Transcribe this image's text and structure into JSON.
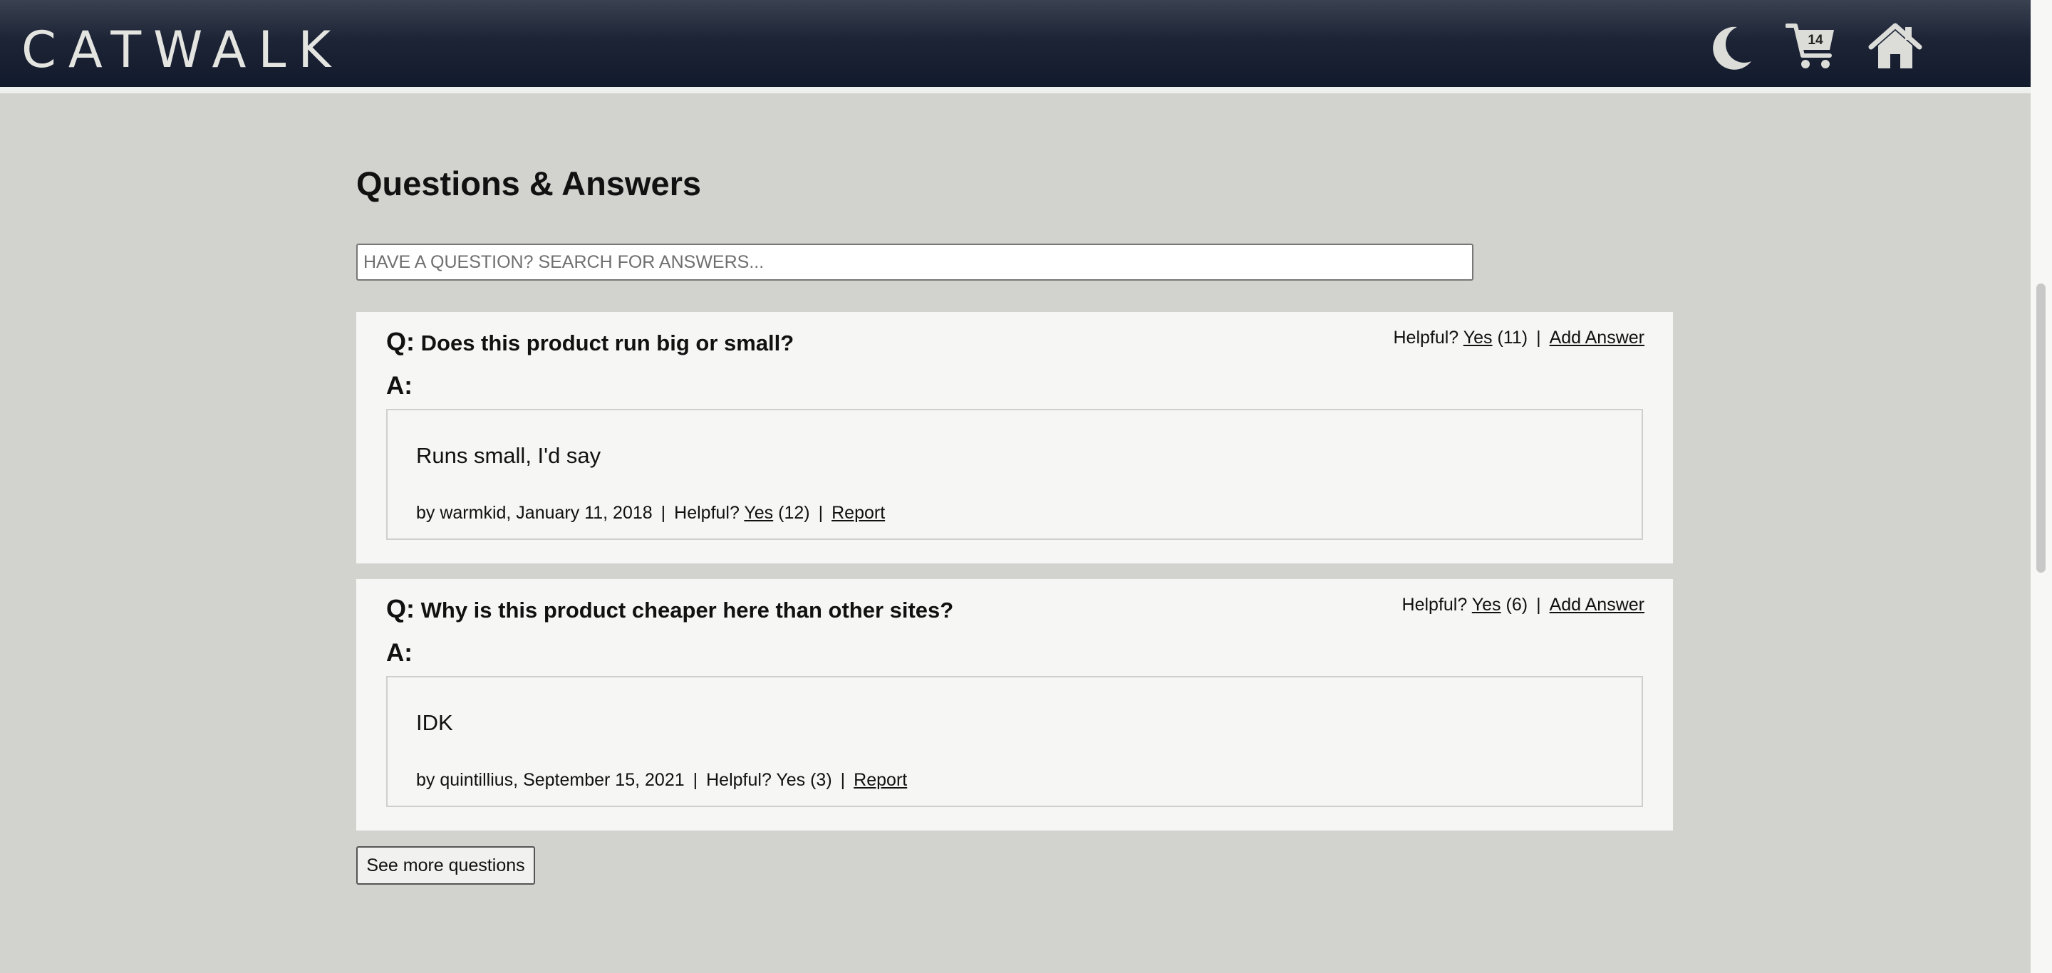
{
  "header": {
    "logo": "CATWALK",
    "cart_count": "14",
    "icons": [
      "moon-icon",
      "cart-icon",
      "home-icon"
    ]
  },
  "qa": {
    "title": "Questions & Answers",
    "search_placeholder": "HAVE A QUESTION? SEARCH FOR ANSWERS...",
    "questions": [
      {
        "prefix": "Q:",
        "text": "Does this product run big or small?",
        "helpful_label": "Helpful?",
        "yes": "Yes",
        "count": "(11)",
        "sep": "|",
        "add_answer": "Add Answer",
        "answer_label": "A:",
        "answer": {
          "body": "Runs small, I'd say",
          "by": "by warmkid, January 11, 2018",
          "helpful_label": "Helpful?",
          "yes": "Yes",
          "count": "(12)",
          "report": "Report"
        }
      },
      {
        "prefix": "Q:",
        "text": "Why is this product cheaper here than other sites?",
        "helpful_label": "Helpful?",
        "yes": "Yes",
        "count": "(6)",
        "sep": "|",
        "add_answer": "Add Answer",
        "answer_label": "A:",
        "answer": {
          "body": "IDK",
          "by": "by quintillius, September 15, 2021",
          "helpful_label": "Helpful?",
          "yes": "Yes",
          "count": "(3)",
          "report": "Report"
        }
      }
    ],
    "more_button": "See more questions"
  },
  "colors": {
    "header_bg": "#111a2c",
    "page_bg": "#d2d3ce",
    "card_bg": "#f6f6f5"
  }
}
